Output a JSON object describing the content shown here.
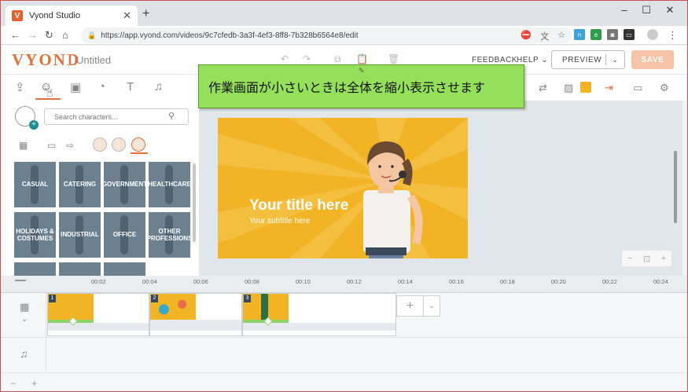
{
  "browser": {
    "tab_title": "Vyond Studio",
    "favicon_letter": "V",
    "url": "https://app.vyond.com/videos/9c7cfedb-3a3f-4ef3-8ff8-7b328b6564e8/edit"
  },
  "header": {
    "logo": "VYOND",
    "doc_title": "Untitled",
    "feedback": "FEEDBACK",
    "help": "HELP",
    "preview": "PREVIEW",
    "save": "SAVE"
  },
  "tooltip": "作業画面が小さいときは全体を縮小表示させます",
  "panel": {
    "search_placeholder": "Search characters...",
    "categories": [
      "CASUAL",
      "CATERING",
      "GOVERNMENT",
      "HEALTHCARE",
      "HOLIDAYS & COSTUMES",
      "INDUSTRIAL",
      "OFFICE",
      "OTHER PROFESSIONS"
    ]
  },
  "scene": {
    "title": "Your title here",
    "subtitle": "Your subtitle here"
  },
  "timeline": {
    "ticks": [
      "00:02",
      "00:04",
      "00:06",
      "00:08",
      "00:10",
      "00:12",
      "00:14",
      "00:16",
      "00:18",
      "00:20",
      "00:22",
      "00:24"
    ],
    "clips": [
      "1",
      "2",
      "3"
    ]
  },
  "colors": {
    "brand_orange": "#e3703a",
    "tooltip_green": "#95e05a",
    "scene_yellow": "#f2b324",
    "category_tile": "#6d8090"
  }
}
